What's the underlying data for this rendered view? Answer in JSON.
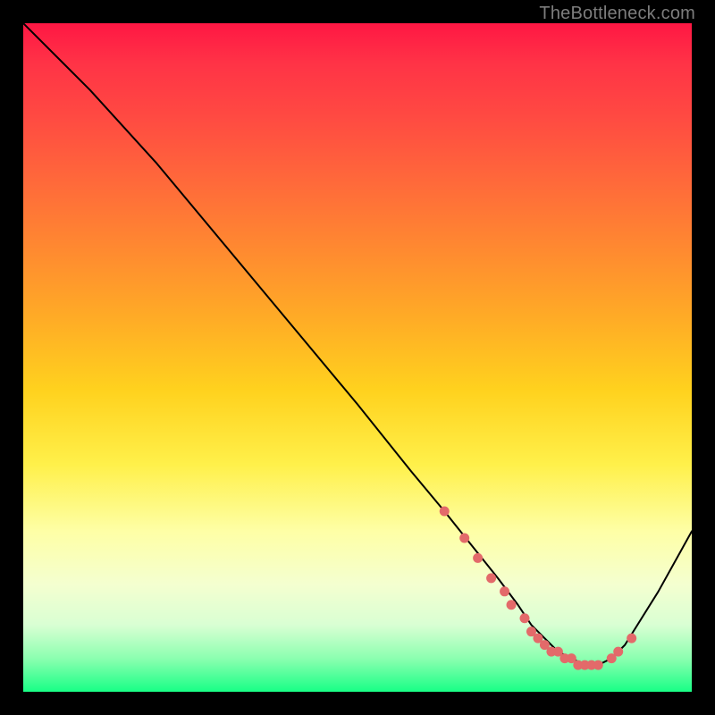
{
  "watermark": "TheBottleneck.com",
  "chart_data": {
    "type": "line",
    "title": "",
    "xlabel": "",
    "ylabel": "",
    "xlim": [
      0,
      100
    ],
    "ylim": [
      0,
      100
    ],
    "grid": false,
    "legend": false,
    "annotations": [],
    "background_gradient": {
      "direction": "vertical",
      "stops": [
        {
          "pos": 0.0,
          "color": "#ff1744"
        },
        {
          "pos": 0.5,
          "color": "#ffc21e"
        },
        {
          "pos": 0.75,
          "color": "#feff9a"
        },
        {
          "pos": 1.0,
          "color": "#18ff86"
        }
      ]
    },
    "series": [
      {
        "name": "bottleneck-curve",
        "stroke": "#000000",
        "x": [
          0,
          6,
          10,
          20,
          30,
          40,
          50,
          58,
          63,
          67,
          71,
          74,
          76,
          78,
          80,
          82,
          84,
          86,
          88,
          90,
          95,
          100
        ],
        "y": [
          100,
          94,
          90,
          79,
          67,
          55,
          43,
          33,
          27,
          22,
          17,
          13,
          10,
          8,
          6,
          5,
          4,
          4,
          5,
          7,
          15,
          24
        ]
      }
    ],
    "markers": {
      "name": "bottleneck-valley-dots",
      "color": "#e36a6a",
      "radius_px": 5.5,
      "x": [
        63,
        66,
        68,
        70,
        72,
        73,
        75,
        76,
        77,
        78,
        79,
        80,
        81,
        82,
        83,
        84,
        85,
        86,
        88,
        89,
        91
      ],
      "y": [
        27,
        23,
        20,
        17,
        15,
        13,
        11,
        9,
        8,
        7,
        6,
        6,
        5,
        5,
        4,
        4,
        4,
        4,
        5,
        6,
        8
      ]
    }
  }
}
